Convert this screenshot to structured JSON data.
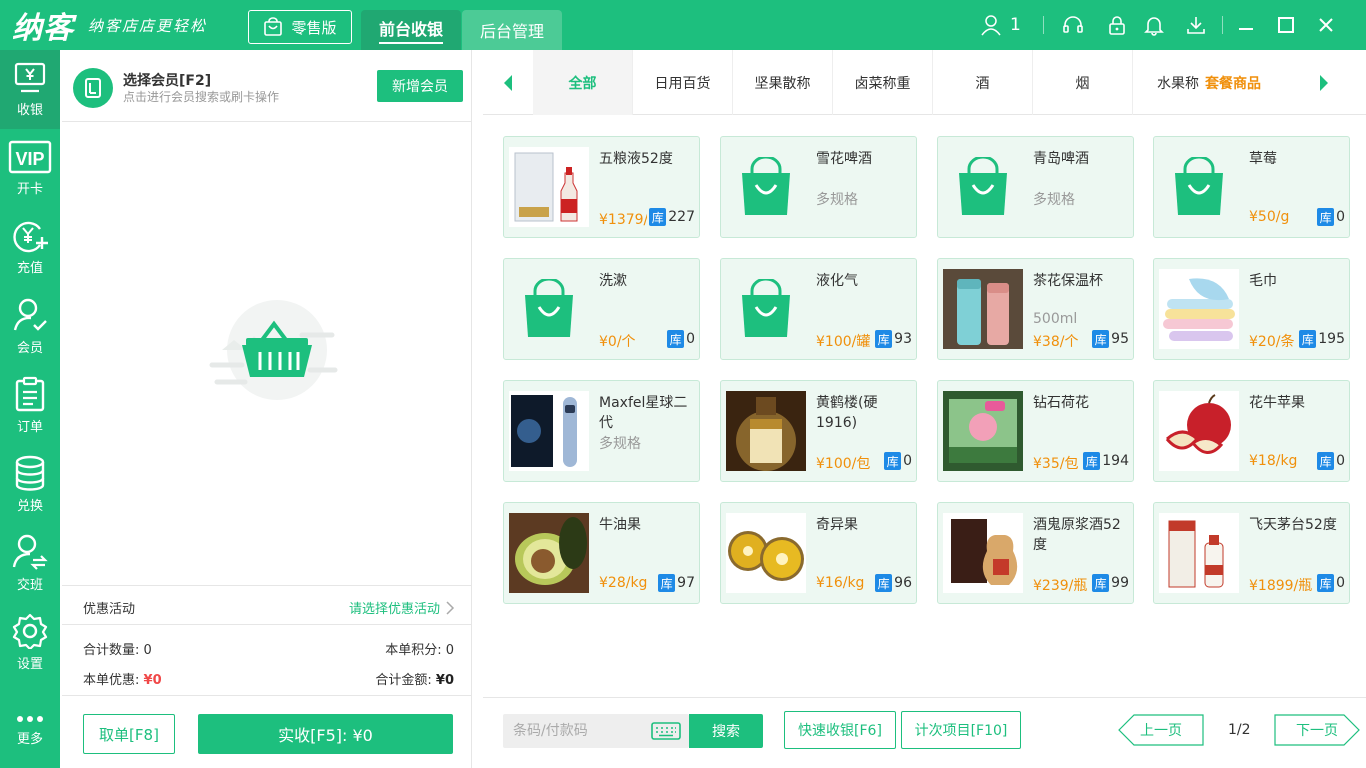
{
  "app": {
    "logo": "纳客",
    "slogan": "纳客店店更轻松",
    "edition": "零售版",
    "tabs": [
      {
        "label": "前台收银",
        "active": true
      },
      {
        "label": "后台管理",
        "active": false
      }
    ],
    "user_count": "1",
    "brand_color": "#1DBF7E"
  },
  "leftnav": [
    {
      "label": "收银",
      "icon": "cashier-icon",
      "active": true
    },
    {
      "label": "开卡",
      "icon": "vip-card-icon"
    },
    {
      "label": "充值",
      "icon": "recharge-icon"
    },
    {
      "label": "会员",
      "icon": "member-icon"
    },
    {
      "label": "订单",
      "icon": "order-icon"
    },
    {
      "label": "兑换",
      "icon": "exchange-icon"
    },
    {
      "label": "交班",
      "icon": "shift-handover-icon"
    },
    {
      "label": "设置",
      "icon": "settings-icon"
    },
    {
      "label": "更多",
      "icon": "more-icon"
    }
  ],
  "member": {
    "title": "选择会员[F2]",
    "subtitle": "点击进行会员搜索或刷卡操作",
    "add_button": "新增会员"
  },
  "promo": {
    "label": "优惠活动",
    "select": "请选择优惠活动"
  },
  "totals": {
    "qty_label": "合计数量:",
    "qty_value": "0",
    "points_label": "本单积分:",
    "points_value": "0",
    "discount_label": "本单优惠:",
    "discount_value": "¥0",
    "amount_label": "合计金额:",
    "amount_value": "¥0"
  },
  "actions": {
    "cancel": "取单[F8]",
    "pay": "实收[F5]:  ¥0"
  },
  "categories": [
    {
      "label": "全部",
      "active": true
    },
    {
      "label": "日用百货"
    },
    {
      "label": "坚果散称"
    },
    {
      "label": "卤菜称重"
    },
    {
      "label": "酒"
    },
    {
      "label": "烟"
    },
    {
      "label": "水果称"
    },
    {
      "label": "套餐商品",
      "highlight": true
    }
  ],
  "products": [
    {
      "name": "五粮液52度",
      "spec": "",
      "price": "¥1379/升",
      "stock": "227",
      "image": "liquor-box"
    },
    {
      "name": "雪花啤酒",
      "spec": "多规格",
      "price": "",
      "stock": "",
      "image": "bag"
    },
    {
      "name": "青岛啤酒",
      "spec": "多规格",
      "price": "",
      "stock": "",
      "image": "bag"
    },
    {
      "name": "草莓",
      "spec": "",
      "price": "¥50/g",
      "stock": "0",
      "image": "bag"
    },
    {
      "name": "洗漱",
      "spec": "",
      "price": "¥0/个",
      "stock": "0",
      "image": "bag"
    },
    {
      "name": "液化气",
      "spec": "",
      "price": "¥100/罐",
      "stock": "93",
      "image": "bag"
    },
    {
      "name": "茶花保温杯",
      "spec": "500ml",
      "price": "¥38/个",
      "stock": "95",
      "image": "thermos"
    },
    {
      "name": "毛巾",
      "spec": "",
      "price": "¥20/条",
      "stock": "195",
      "image": "towel"
    },
    {
      "name": "Maxfel星球二代",
      "spec": "多规格",
      "price": "",
      "stock": "",
      "image": "device"
    },
    {
      "name": "黄鹤楼(硬1916)",
      "spec": "",
      "price": "¥100/包",
      "stock": "0",
      "image": "cigarette"
    },
    {
      "name": "钻石荷花",
      "spec": "",
      "price": "¥35/包",
      "stock": "194",
      "image": "lotus"
    },
    {
      "name": "花牛苹果",
      "spec": "",
      "price": "¥18/kg",
      "stock": "0",
      "image": "apple"
    },
    {
      "name": "牛油果",
      "spec": "",
      "price": "¥28/kg",
      "stock": "97",
      "image": "avocado"
    },
    {
      "name": "奇异果",
      "spec": "",
      "price": "¥16/kg",
      "stock": "96",
      "image": "kiwi"
    },
    {
      "name": "酒鬼原浆酒52度",
      "spec": "",
      "price": "¥239/瓶",
      "stock": "99",
      "image": "liquor-jar"
    },
    {
      "name": "飞天茅台52度",
      "spec": "",
      "price": "¥1899/瓶",
      "stock": "0",
      "image": "moutai"
    }
  ],
  "stock_tag": "库",
  "bottom": {
    "barcode_placeholder": "条码/付款码",
    "search": "搜索",
    "quick_pay": "快速收银[F6]",
    "count_items": "计次项目[F10]",
    "prev": "上一页",
    "next": "下一页",
    "page": "1/2"
  }
}
